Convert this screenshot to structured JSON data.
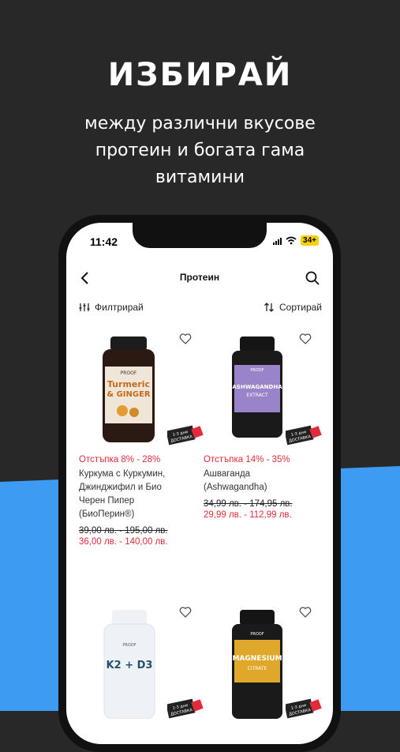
{
  "promo": {
    "headline": "ИЗБИРАЙ",
    "subtitle_lines": [
      "между различни вкусове",
      "протеин и богата гама",
      "витамини"
    ]
  },
  "status_bar": {
    "time": "11:42",
    "battery": "34+"
  },
  "navbar": {
    "title": "Протеин",
    "back_icon": "chevron-left-icon",
    "search_icon": "search-icon"
  },
  "toolbar": {
    "filter_label": "Филтрирай",
    "sort_label": "Сортирай"
  },
  "products": [
    {
      "discount": "Отстъпка 8% - 28%",
      "name_lines": [
        "Куркума с Куркумин,",
        "Джинджифил и Био",
        "Черен Пипер",
        "(БиоПерин®)"
      ],
      "old_price": "39,00 лв. - 195,00 лв.",
      "new_price": "36,00 лв. - 140,00 лв.",
      "label_brand": "PROOF",
      "label_line1": "Turmeric",
      "label_line2": "& GINGER",
      "badge_lines": [
        "1-3 дни",
        "ДОСТАВКА"
      ]
    },
    {
      "discount": "Отстъпка 14% - 35%",
      "name_lines": [
        "Ашваганда",
        "(Ashwagandha)"
      ],
      "old_price": "34,99 лв. - 174,95 лв.",
      "new_price": "29,99 лв. - 112,99 лв.",
      "label_brand": "PROOF",
      "label_line1": "ASHWAGANDHA",
      "label_line2": "EXTRACT",
      "badge_lines": [
        "1-3 дни",
        "ДОСТАВКА"
      ]
    },
    {
      "label_brand": "PROOF",
      "label_line1": "K2 + D3",
      "badge_lines": [
        "1-3 дни",
        "ДОСТАВКА"
      ]
    },
    {
      "label_brand": "PROOF",
      "label_line1": "MAGNESIUM",
      "label_line2": "CITRATE",
      "badge_lines": [
        "1-3 дни",
        "ДОСТАВКА"
      ]
    }
  ],
  "colors": {
    "accent_red": "#e12a3a",
    "background_dark": "#282828",
    "background_blue": "#3d9cf2"
  }
}
